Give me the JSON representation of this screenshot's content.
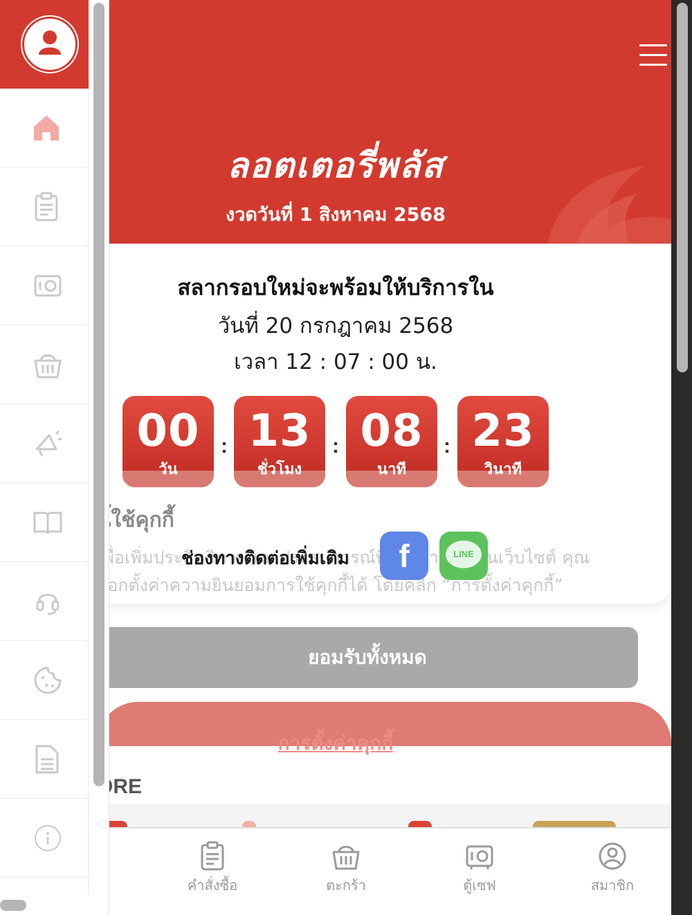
{
  "header": {
    "logo_text": "ลอตเตอรี่พลัส",
    "draw_date": "งวดวันที่  1 สิงหาคม 2568",
    "menu_icon": "hamburger-menu-icon"
  },
  "notice": {
    "title": "สลากรอบใหม่จะพร้อมให้บริการใน",
    "date": "วันที่ 20 กรกฎาคม 2568",
    "time": "เวลา 12 : 07 : 00 น."
  },
  "countdown": {
    "days": "00",
    "days_label": "วัน",
    "hours": "13",
    "hours_label": "ชั่วโมง",
    "minutes": "08",
    "minutes_label": "นาที",
    "seconds": "23",
    "seconds_label": "วินาที",
    "separator": ":"
  },
  "cookie": {
    "title": "นี้ใช้คุกกี้",
    "line1": "ี้เพื่อเพิ่มประสิทธิภาพและประสบการณ์ที่ดีในการใช้งานเว็บไซต์ คุณ",
    "line2": "ลือกตั้งค่าความยินยอมการใช้คุกกี้ได้ โดยคลิก “การตั้งค่าคุกกี้”",
    "accept_label": "ยอมรับทั้งหมด",
    "settings_label": "การตั้งค่าคุกกี้"
  },
  "contact": {
    "label": "ช่องทางติดต่อเพิ่มเติม",
    "facebook_glyph": "f",
    "line_text": "LINE"
  },
  "more": {
    "title": "ORE"
  },
  "bottom_nav": {
    "items": [
      {
        "label": "คำสั่งซื้อ",
        "icon": "clipboard-icon"
      },
      {
        "label": "ตะกร้า",
        "icon": "basket-icon"
      },
      {
        "label": "ตู้เซฟ",
        "icon": "safe-icon"
      },
      {
        "label": "สมาชิก",
        "icon": "user-icon"
      }
    ]
  },
  "drawer": {
    "items": [
      "home-icon",
      "clipboard-icon",
      "safe-icon",
      "basket-icon",
      "megaphone-icon",
      "book-icon",
      "headset-icon",
      "cookie-icon",
      "document-icon",
      "info-icon"
    ]
  },
  "colors": {
    "brand_red": "#d33a2f",
    "muted_icon": "#c9c9c9",
    "accept_gray": "#a9a9a9",
    "facebook_blue": "#5f87e8",
    "line_green": "#5cc35c"
  }
}
